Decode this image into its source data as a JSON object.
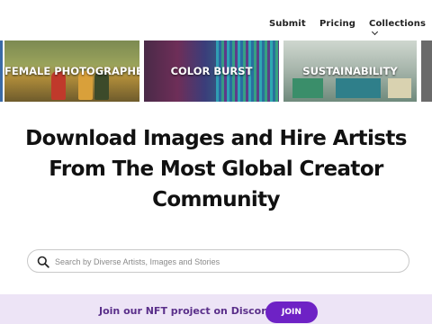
{
  "nav": {
    "submit": "Submit",
    "pricing": "Pricing",
    "collections": "Collections"
  },
  "collections_strip": [
    {
      "label": ""
    },
    {
      "label": "FEMALE PHOTOGRAPHERS"
    },
    {
      "label": "COLOR BURST"
    },
    {
      "label": "SUSTAINABILITY"
    },
    {
      "label": ""
    }
  ],
  "hero": {
    "headline_line1": "Download Images and Hire Artists",
    "headline_line2": "From The Most Global Creator",
    "headline_line3": "Community"
  },
  "search": {
    "placeholder": "Search by Diverse Artists, Images and Stories"
  },
  "banner": {
    "text": "Join our NFT project on Discord",
    "button_label": "JOIN"
  },
  "colors": {
    "accent": "#6e22c5",
    "banner_bg": "#ede4f6",
    "banner_text": "#5a2f8a"
  },
  "icons": {
    "search": "search-icon",
    "collections_dropdown": "chevron-down-icon"
  }
}
